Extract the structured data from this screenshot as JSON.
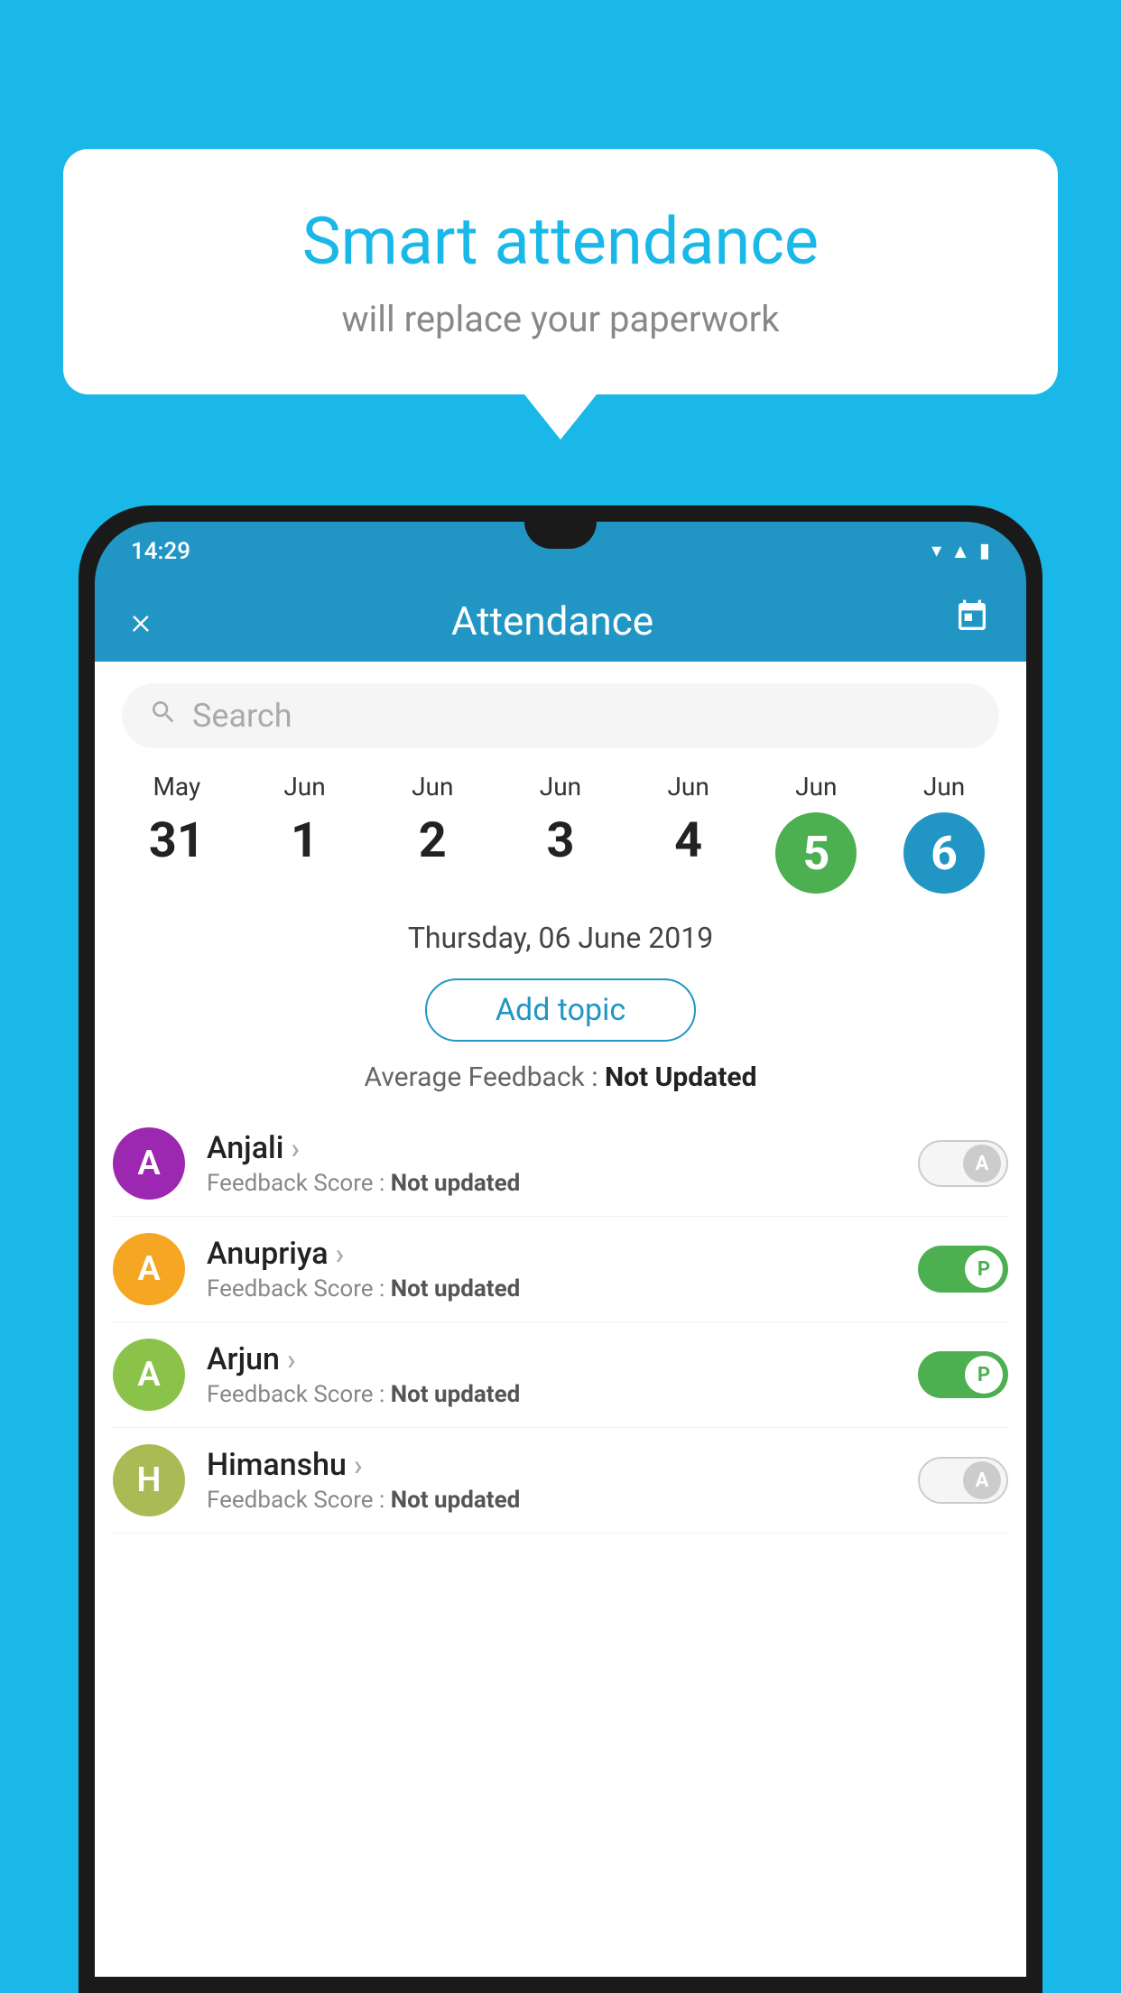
{
  "background_color": "#1ab8e8",
  "speech_bubble": {
    "title": "Smart attendance",
    "subtitle": "will replace your paperwork"
  },
  "status_bar": {
    "time": "14:29"
  },
  "header": {
    "title": "Attendance",
    "close_icon": "×",
    "calendar_icon": "📅"
  },
  "search": {
    "placeholder": "Search"
  },
  "dates": [
    {
      "month": "May",
      "day": "31",
      "highlight": false
    },
    {
      "month": "Jun",
      "day": "1",
      "highlight": false
    },
    {
      "month": "Jun",
      "day": "2",
      "highlight": false
    },
    {
      "month": "Jun",
      "day": "3",
      "highlight": false
    },
    {
      "month": "Jun",
      "day": "4",
      "highlight": false
    },
    {
      "month": "Jun",
      "day": "5",
      "highlight": "green"
    },
    {
      "month": "Jun",
      "day": "6",
      "highlight": "blue"
    }
  ],
  "selected_date": "Thursday, 06 June 2019",
  "add_topic_label": "Add topic",
  "average_feedback_label": "Average Feedback :",
  "average_feedback_value": "Not Updated",
  "students": [
    {
      "name": "Anjali",
      "initial": "A",
      "avatar_color": "#9c27b0",
      "feedback_label": "Feedback Score :",
      "feedback_value": "Not updated",
      "toggle_state": "absent",
      "toggle_label": "A"
    },
    {
      "name": "Anupriya",
      "initial": "A",
      "avatar_color": "#f5a623",
      "feedback_label": "Feedback Score :",
      "feedback_value": "Not updated",
      "toggle_state": "present",
      "toggle_label": "P"
    },
    {
      "name": "Arjun",
      "initial": "A",
      "avatar_color": "#8bc34a",
      "feedback_label": "Feedback Score :",
      "feedback_value": "Not updated",
      "toggle_state": "present",
      "toggle_label": "P"
    },
    {
      "name": "Himanshu",
      "initial": "H",
      "avatar_color": "#aabb55",
      "feedback_label": "Feedback Score :",
      "feedback_value": "Not updated",
      "toggle_state": "absent",
      "toggle_label": "A"
    }
  ]
}
